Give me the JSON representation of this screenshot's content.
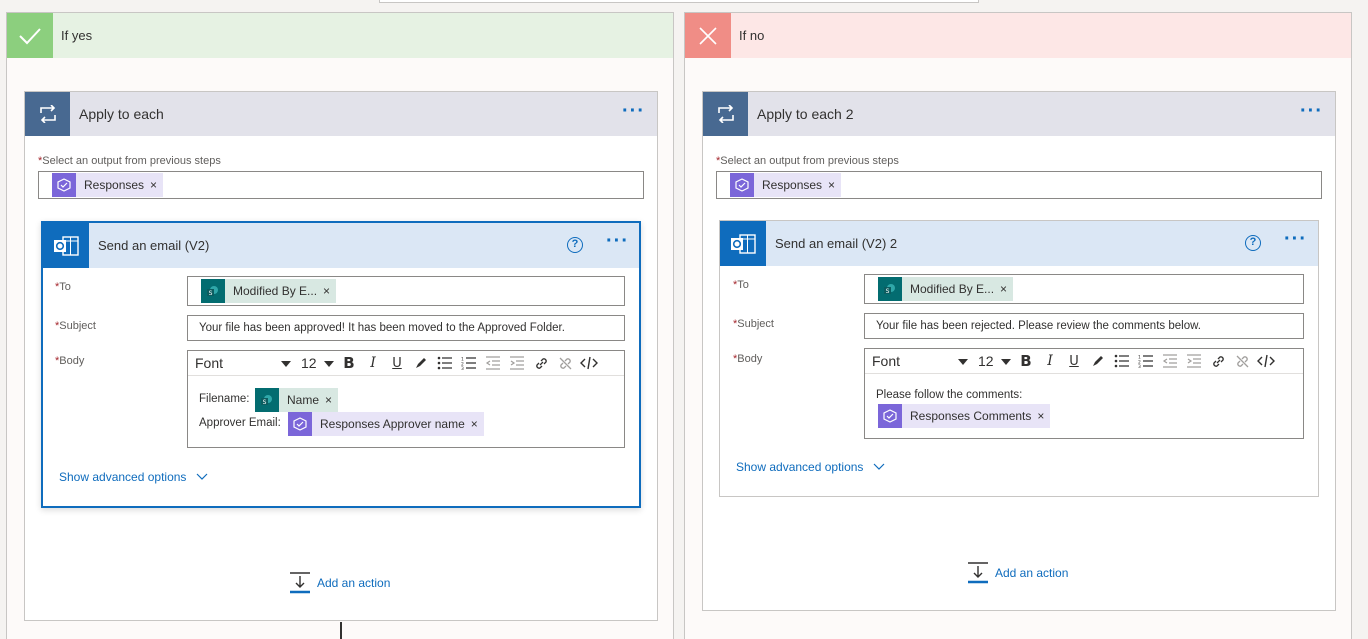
{
  "branches": {
    "yes": {
      "title": "If yes",
      "loop": {
        "title": "Apply to each",
        "output_label": "Select an output from previous steps",
        "output_token": "Responses",
        "email": {
          "title": "Send an email (V2)",
          "to_label": "To",
          "to_token": "Modified By E...",
          "subject_label": "Subject",
          "subject_value": "Your file has been approved! It has been moved to the Approved Folder.",
          "body_label": "Body",
          "toolbar": {
            "font": "Font",
            "size": "12"
          },
          "body_line1": "Filename:",
          "body_token1": "Name",
          "body_line2": "Approver Email:",
          "body_token2": "Responses Approver name",
          "advanced": "Show advanced options"
        },
        "add_action": "Add an action"
      }
    },
    "no": {
      "title": "If no",
      "loop": {
        "title": "Apply to each 2",
        "output_label": "Select an output from previous steps",
        "output_token": "Responses",
        "email": {
          "title": "Send an email (V2) 2",
          "to_label": "To",
          "to_token": "Modified By E...",
          "subject_label": "Subject",
          "subject_value": "Your file has been rejected. Please review the comments below.",
          "body_label": "Body",
          "toolbar": {
            "font": "Font",
            "size": "12"
          },
          "body_line1": "Please follow the comments:",
          "body_token1": "Responses Comments",
          "advanced": "Show advanced options"
        },
        "add_action": "Add an action"
      }
    }
  },
  "common": {
    "star": "*",
    "token_remove": "×",
    "more": "···",
    "help": "?"
  },
  "colors": {
    "accent": "#0f6cbd",
    "yes": "#8ccf7e",
    "no": "#f08d86",
    "loop": "#486991",
    "forms": "#7b66d9",
    "sharepoint": "#036c70"
  }
}
